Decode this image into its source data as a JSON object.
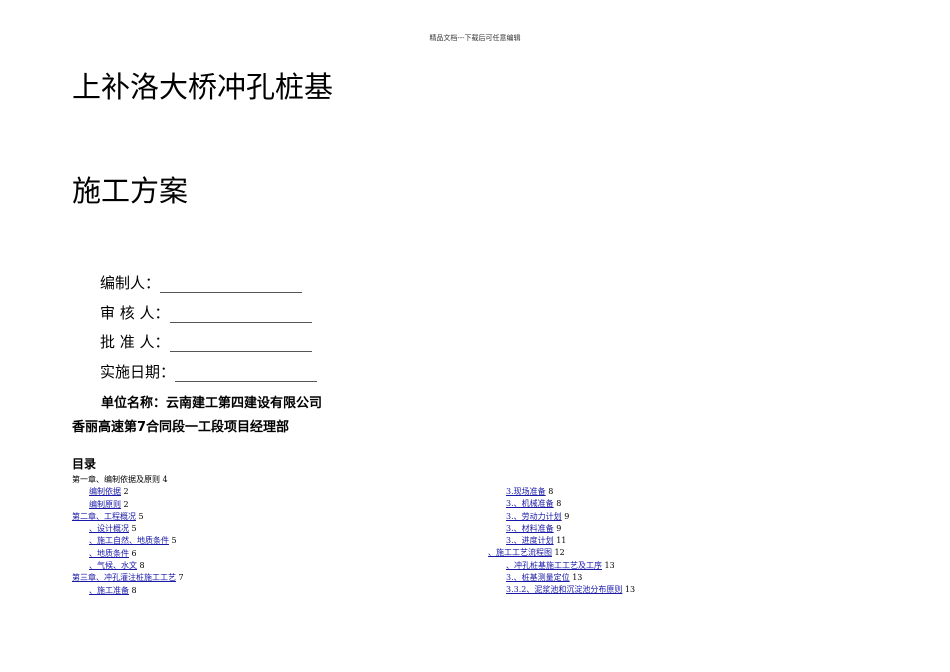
{
  "header": "精品文档---下载后可任意编辑",
  "title_line1": "上补洛大桥冲孔桩基",
  "title_line2": "施工方案",
  "signatures": [
    {
      "label": "编制人："
    },
    {
      "label": "审  核  人："
    },
    {
      "label": "批  准  人："
    },
    {
      "label": "实施日期："
    }
  ],
  "unit": "单位名称：云南建工第四建设有限公司",
  "dept": "香丽高速第7合同段一工段项目经理部",
  "toc_title": "目录",
  "toc_left": [
    {
      "text": "第一章、编制依据及原则",
      "page": "4",
      "indent": 0,
      "link": false
    },
    {
      "text": "编制依据",
      "page": "2",
      "indent": 1,
      "link": true
    },
    {
      "text": "编制原则",
      "page": "2",
      "indent": 1,
      "link": true
    },
    {
      "text": "第二章、工程概况",
      "page": "5",
      "indent": 0,
      "link": true
    },
    {
      "text": "、设计概况",
      "page": "5",
      "indent": 1,
      "link": true
    },
    {
      "text": "、施工自然、地质条件",
      "page": "5",
      "indent": 1,
      "link": true
    },
    {
      "text": "、地质条件",
      "page": "6",
      "indent": 1,
      "link": true
    },
    {
      "text": "、气候、水文",
      "page": "8",
      "indent": 1,
      "link": true
    },
    {
      "text": "第三章、冲孔灌注桩施工工艺",
      "page": "7",
      "indent": 0,
      "link": true
    },
    {
      "text": "、施工准备",
      "page": "8",
      "indent": 1,
      "link": true
    }
  ],
  "toc_right": [
    {
      "text": "3.现场准备",
      "page": "8",
      "indent": 1
    },
    {
      "text": "3.、机械准备",
      "page": "8",
      "indent": 1
    },
    {
      "text": "3.、劳动力计划",
      "page": "9",
      "indent": 1
    },
    {
      "text": "3.、材料准备",
      "page": "9",
      "indent": 1
    },
    {
      "text": "3.、进度计划",
      "page": "11",
      "indent": 1
    },
    {
      "text": "、施工工艺流程图",
      "page": "12",
      "indent": 0
    },
    {
      "text": "、冲孔桩基施工工艺及工序",
      "page": "13",
      "indent": 1
    },
    {
      "text": "3.、桩基测量定位",
      "page": "13",
      "indent": 1
    },
    {
      "text": "3.3.2、泥浆池和沉淀池分布原则",
      "page": "13",
      "indent": 1
    }
  ]
}
